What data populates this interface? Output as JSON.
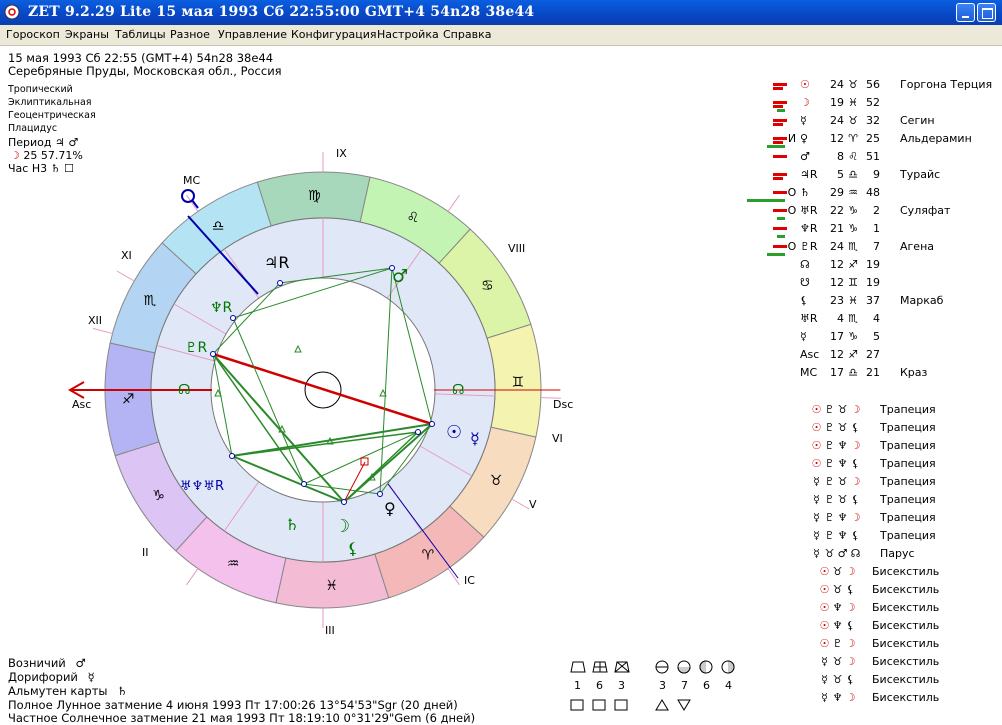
{
  "window": {
    "title": "ZET 9.2.29 Lite    15 мая 1993  Сб   22:55:00 GMT+4 54n28  38e44"
  },
  "menu": [
    "Гороскоп",
    "Экраны",
    "Таблицы",
    "Разное",
    "Управление",
    "Конфигурация",
    "Настройка",
    "Справка"
  ],
  "header": {
    "line1": "15 мая 1993   Сб   22:55 (GMT+4) 54n28  38e44",
    "line2": "Серебряные Пруды, Московская обл., Россия"
  },
  "settings": [
    "Тропический",
    "Эклиптикальная",
    "Геоцентрическая",
    "Плацидус"
  ],
  "period": {
    "label": "Период",
    "symbols": "♃ ♂"
  },
  "moon_phase": {
    "symbol": "☽",
    "text": "25 57.71%"
  },
  "hour": {
    "label": "Час Н3",
    "symbols": "♄ ☐"
  },
  "wheel": {
    "houses": [
      {
        "label": "Asc"
      },
      {
        "label": "II"
      },
      {
        "label": "III"
      },
      {
        "label": "IC"
      },
      {
        "label": "V"
      },
      {
        "label": "VI"
      },
      {
        "label": "Dsc"
      },
      {
        "label": "VIII"
      },
      {
        "label": "IX"
      },
      {
        "label": "MC"
      },
      {
        "label": "XI"
      },
      {
        "label": "XII"
      }
    ],
    "signs": [
      {
        "glyph": "♐",
        "color": "#b4b4f4"
      },
      {
        "glyph": "♑",
        "color": "#dcc4f4"
      },
      {
        "glyph": "♒",
        "color": "#f4c0ec"
      },
      {
        "glyph": "♓",
        "color": "#f4bcd4"
      },
      {
        "glyph": "♈",
        "color": "#f4b8b8"
      },
      {
        "glyph": "♉",
        "color": "#f8dcc0"
      },
      {
        "glyph": "♊",
        "color": "#f4f4b0"
      },
      {
        "glyph": "♋",
        "color": "#dcf4a8"
      },
      {
        "glyph": "♌",
        "color": "#c4f4b4"
      },
      {
        "glyph": "♍",
        "color": "#a8d8bc"
      },
      {
        "glyph": "♎",
        "color": "#b4e4f4"
      },
      {
        "glyph": "♏",
        "color": "#b4d4f4"
      }
    ],
    "planet_glyphs": [
      {
        "name": "jupiter",
        "glyph": "♃R",
        "color": "#000000"
      },
      {
        "name": "mars",
        "glyph": "♂",
        "color": "#007700"
      },
      {
        "name": "neptune",
        "glyph": "♆R",
        "color": "#007700"
      },
      {
        "name": "pluto",
        "glyph": "♇R",
        "color": "#007700"
      },
      {
        "name": "node",
        "glyph": "☊",
        "color": "#007700"
      },
      {
        "name": "sun",
        "glyph": "☉",
        "color": "#0000aa"
      },
      {
        "name": "mercury",
        "glyph": "☿",
        "color": "#0000aa"
      },
      {
        "name": "venus",
        "glyph": "♀",
        "color": "#000000"
      },
      {
        "name": "moon",
        "glyph": "☽",
        "color": "#007700"
      },
      {
        "name": "lilith",
        "glyph": "⚸",
        "color": "#007700"
      },
      {
        "name": "saturn",
        "glyph": "♄",
        "color": "#007700"
      },
      {
        "name": "uranus-neptune-group",
        "glyph": "♅♆♅R",
        "color": "#0000aa"
      }
    ]
  },
  "planets": [
    {
      "glyph": "☉",
      "mark": "",
      "deg": "24",
      "sign": "♉",
      "min": "56",
      "star": "Горгона Терция",
      "glyph_color": "#d00000"
    },
    {
      "glyph": "☽",
      "mark": "",
      "deg": "19",
      "sign": "♓",
      "min": "52",
      "star": "",
      "glyph_color": "#d00000"
    },
    {
      "glyph": "☿",
      "mark": "",
      "deg": "24",
      "sign": "♉",
      "min": "32",
      "star": "Сегин",
      "glyph_color": "#000000"
    },
    {
      "glyph": "♀",
      "mark": "И",
      "deg": "12",
      "sign": "♈",
      "min": "25",
      "star": "Альдерамин",
      "glyph_color": "#000000"
    },
    {
      "glyph": "♂",
      "mark": "",
      "deg": "8",
      "sign": "♌",
      "min": "51",
      "star": "",
      "glyph_color": "#000000"
    },
    {
      "glyph": "♃R",
      "mark": "",
      "deg": "5",
      "sign": "♎",
      "min": "9",
      "star": "Турайс",
      "glyph_color": "#000000"
    },
    {
      "glyph": "♄",
      "mark": "О",
      "deg": "29",
      "sign": "♒",
      "min": "48",
      "star": "",
      "glyph_color": "#000000"
    },
    {
      "glyph": "♅R",
      "mark": "О",
      "deg": "22",
      "sign": "♑",
      "min": "2",
      "star": "Суляфат",
      "glyph_color": "#000000"
    },
    {
      "glyph": "♆R",
      "mark": "",
      "deg": "21",
      "sign": "♑",
      "min": "1",
      "star": "",
      "glyph_color": "#000000"
    },
    {
      "glyph": "♇R",
      "mark": "О",
      "deg": "24",
      "sign": "♏",
      "min": "7",
      "star": "Агена",
      "glyph_color": "#000000"
    },
    {
      "glyph": "☊",
      "mark": "",
      "deg": "12",
      "sign": "♐",
      "min": "19",
      "star": "",
      "glyph_color": "#000000"
    },
    {
      "glyph": "☋",
      "mark": "",
      "deg": "12",
      "sign": "♊",
      "min": "19",
      "star": "",
      "glyph_color": "#000000"
    },
    {
      "glyph": "⚸",
      "mark": "",
      "deg": "23",
      "sign": "♓",
      "min": "37",
      "star": "Маркаб",
      "glyph_color": "#000000"
    },
    {
      "glyph": "♅R",
      "mark": "",
      "deg": "4",
      "sign": "♏",
      "min": "4",
      "star": "",
      "glyph_color": "#000000"
    },
    {
      "glyph": "☿",
      "mark": "",
      "deg": "17",
      "sign": "♑",
      "min": "5",
      "star": "",
      "glyph_color": "#000000"
    },
    {
      "glyph": "Asc",
      "mark": "",
      "deg": "12",
      "sign": "♐",
      "min": "27",
      "star": "",
      "glyph_color": "#000000"
    },
    {
      "glyph": "MC",
      "mark": "",
      "deg": "17",
      "sign": "♎",
      "min": "21",
      "star": "Краз",
      "glyph_color": "#000000"
    }
  ],
  "strength_bars": [
    {
      "red": 2,
      "green": 0
    },
    {
      "red": 2,
      "green": 1
    },
    {
      "red": 2,
      "green": 0
    },
    {
      "red": 2,
      "green": 2
    },
    {
      "red": 1,
      "green": 0
    },
    {
      "red": 2,
      "green": 0
    },
    {
      "red": 1,
      "green": 4
    },
    {
      "red": 1,
      "green": 1
    },
    {
      "red": 1,
      "green": 1
    },
    {
      "red": 1,
      "green": 2
    }
  ],
  "aspects": [
    {
      "g1": "☉",
      "g2": "♇",
      "g3": "♉",
      "g4": "☽",
      "label": "Трапеция"
    },
    {
      "g1": "☉",
      "g2": "♇",
      "g3": "♉",
      "g4": "⚸",
      "label": "Трапеция"
    },
    {
      "g1": "☉",
      "g2": "♇",
      "g3": "♆",
      "g4": "☽",
      "label": "Трапеция"
    },
    {
      "g1": "☉",
      "g2": "♇",
      "g3": "♆",
      "g4": "⚸",
      "label": "Трапеция"
    },
    {
      "g1": "☿",
      "g2": "♇",
      "g3": "♉",
      "g4": "☽",
      "label": "Трапеция"
    },
    {
      "g1": "☿",
      "g2": "♇",
      "g3": "♉",
      "g4": "⚸",
      "label": "Трапеция"
    },
    {
      "g1": "☿",
      "g2": "♇",
      "g3": "♆",
      "g4": "☽",
      "label": "Трапеция"
    },
    {
      "g1": "☿",
      "g2": "♇",
      "g3": "♆",
      "g4": "⚸",
      "label": "Трапеция"
    },
    {
      "g1": "☿",
      "g2": "♉",
      "g3": "♂",
      "g4": "☊",
      "label": "Парус"
    },
    {
      "g1": "☉",
      "g2": "♉",
      "g3": "☽",
      "g4": "",
      "label": "Бисекстиль"
    },
    {
      "g1": "☉",
      "g2": "♉",
      "g3": "⚸",
      "g4": "",
      "label": "Бисекстиль"
    },
    {
      "g1": "☉",
      "g2": "♆",
      "g3": "☽",
      "g4": "",
      "label": "Бисекстиль"
    },
    {
      "g1": "☉",
      "g2": "♆",
      "g3": "⚸",
      "g4": "",
      "label": "Бисекстиль"
    },
    {
      "g1": "☉",
      "g2": "♇",
      "g3": "☽",
      "g4": "",
      "label": "Бисекстиль"
    },
    {
      "g1": "☿",
      "g2": "♉",
      "g3": "☽",
      "g4": "",
      "label": "Бисекстиль"
    },
    {
      "g1": "☿",
      "g2": "♉",
      "g3": "⚸",
      "g4": "",
      "label": "Бисекстиль"
    },
    {
      "g1": "☿",
      "g2": "♆",
      "g3": "☽",
      "g4": "",
      "label": "Бисекстиль"
    }
  ],
  "footer": {
    "vozn_label": "Возничий",
    "vozn_sym": "♂",
    "dor_label": "Дорифорий",
    "dor_sym": "☿",
    "alm_label": "Альмутен карты",
    "alm_sym": "♄",
    "eclipse1": "Полное Лунное затмение 4 июня 1993 Пт 17:00:26 13°54'53\"Sgr (20 дней)",
    "eclipse2": "Частное Солнечное затмение 21 мая 1993 Пт 18:19:10  0°31'29\"Gem (6 дней)"
  },
  "element_counts": {
    "left": [
      {
        "n": "1"
      },
      {
        "n": "6"
      },
      {
        "n": "3"
      }
    ],
    "right": [
      {
        "n": "3"
      },
      {
        "n": "7"
      },
      {
        "n": "6"
      },
      {
        "n": "4"
      }
    ]
  }
}
